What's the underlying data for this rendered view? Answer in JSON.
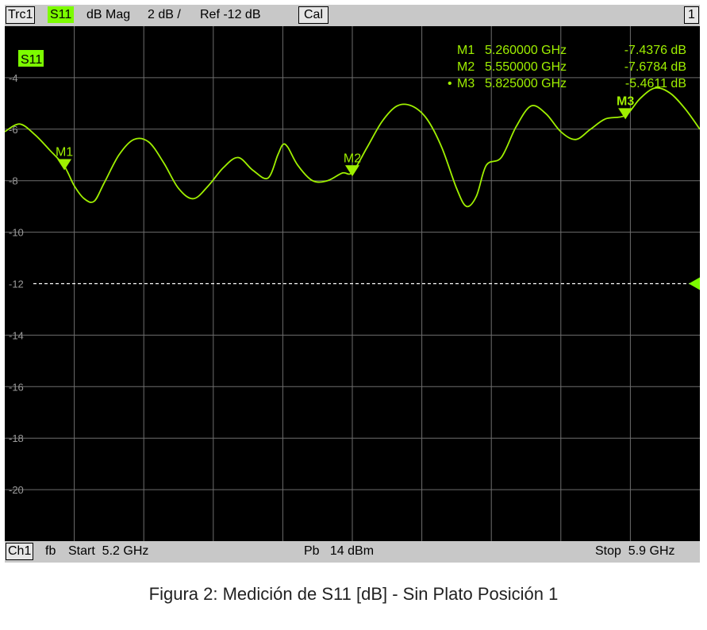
{
  "header": {
    "trace": "Trc1",
    "param": "S11",
    "format": "dB Mag",
    "scale": "2 dB /",
    "ref": "Ref -12 dB",
    "cal": "Cal",
    "window_num": "1"
  },
  "footer": {
    "channel": "Ch1",
    "fb": "fb",
    "start": "Start  5.2 GHz",
    "power": "Pb   14 dBm",
    "stop": "Stop  5.9 GHz"
  },
  "trace_label": "S11",
  "markers": [
    {
      "name": "M1",
      "label": "M1",
      "freq": "5.260000 GHz",
      "value": "-7.4376 dB",
      "x": 5.26,
      "y": -7.4376,
      "active": false
    },
    {
      "name": "M2",
      "label": "M2",
      "freq": "5.550000 GHz",
      "value": "-7.6784 dB",
      "x": 5.55,
      "y": -7.6784,
      "active": false
    },
    {
      "name": "M3",
      "label": "M3",
      "freq": "5.825000 GHz",
      "value": "-5.4611 dB",
      "x": 5.825,
      "y": -5.4611,
      "active": true
    }
  ],
  "caption": "Figura 2: Medición de S11 [dB] - Sin Plato Posición 1",
  "colors": {
    "trace": "#9ff000",
    "grid": "#6e6e6e",
    "background": "#000000",
    "accent": "#7cfc00"
  },
  "chart_data": {
    "type": "line",
    "xlabel": "",
    "ylabel": "",
    "xlim": [
      5.2,
      5.9
    ],
    "ylim": [
      -22,
      -2
    ],
    "y_ticks": [
      -4,
      -6,
      -8,
      -10,
      -12,
      -14,
      -16,
      -18,
      -20
    ],
    "reference_level": -12,
    "grid": true,
    "series": [
      {
        "x": [
          5.2,
          5.215,
          5.23,
          5.245,
          5.26,
          5.27,
          5.28,
          5.29,
          5.3,
          5.315,
          5.33,
          5.345,
          5.36,
          5.375,
          5.39,
          5.405,
          5.42,
          5.435,
          5.45,
          5.465,
          5.475,
          5.48,
          5.485,
          5.495,
          5.51,
          5.525,
          5.54,
          5.55,
          5.565,
          5.58,
          5.595,
          5.61,
          5.625,
          5.64,
          5.655,
          5.665,
          5.675,
          5.685,
          5.7,
          5.715,
          5.73,
          5.745,
          5.76,
          5.775,
          5.79,
          5.805,
          5.825,
          5.84,
          5.855,
          5.87,
          5.885,
          5.9
        ],
        "y": [
          -6.1,
          -5.8,
          -6.2,
          -6.8,
          -7.44,
          -8.2,
          -8.7,
          -8.8,
          -8.1,
          -7.0,
          -6.4,
          -6.5,
          -7.3,
          -8.3,
          -8.7,
          -8.2,
          -7.5,
          -7.1,
          -7.6,
          -7.9,
          -7.0,
          -6.6,
          -6.7,
          -7.4,
          -8.0,
          -8.0,
          -7.7,
          -7.68,
          -6.7,
          -5.7,
          -5.1,
          -5.1,
          -5.6,
          -6.7,
          -8.3,
          -9.0,
          -8.6,
          -7.4,
          -7.1,
          -5.9,
          -5.1,
          -5.4,
          -6.1,
          -6.4,
          -6.0,
          -5.6,
          -5.46,
          -4.8,
          -4.4,
          -4.6,
          -5.2,
          -6.0
        ]
      }
    ]
  }
}
